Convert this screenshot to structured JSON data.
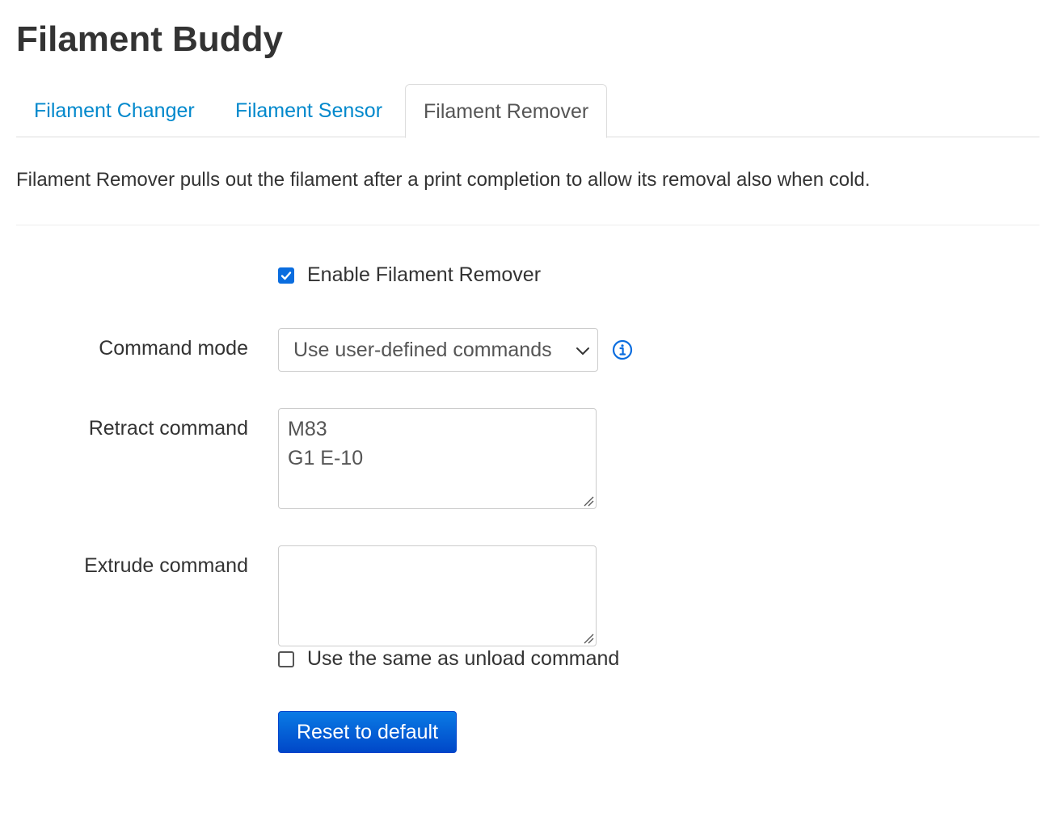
{
  "page": {
    "title": "Filament Buddy"
  },
  "tabs": [
    {
      "label": "Filament Changer",
      "active": false
    },
    {
      "label": "Filament Sensor",
      "active": false
    },
    {
      "label": "Filament Remover",
      "active": true
    }
  ],
  "description": "Filament Remover pulls out the filament after a print completion to allow its removal also when cold.",
  "form": {
    "enable": {
      "label": "Enable Filament Remover",
      "checked": true
    },
    "command_mode": {
      "label": "Command mode",
      "selected": "Use user-defined commands",
      "info_icon": "info-circle-icon"
    },
    "retract": {
      "label": "Retract command",
      "lines": [
        "M83",
        "G1 E-10"
      ]
    },
    "extrude": {
      "label": "Extrude command",
      "value": ""
    },
    "same_as_unload": {
      "label": "Use the same as unload command",
      "checked": false
    },
    "reset_button": "Reset to default"
  },
  "colors": {
    "link": "#0088cc",
    "accent": "#0a6ddf",
    "button_top": "#0a7be5",
    "button_bottom": "#0047c8"
  }
}
